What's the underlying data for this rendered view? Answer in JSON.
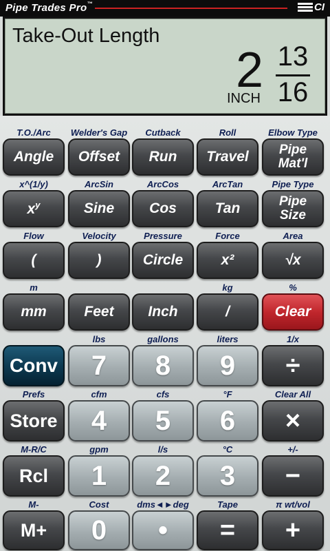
{
  "header": {
    "app_title": "Pipe Trades Pro",
    "tm": "™",
    "brand": "CI"
  },
  "display": {
    "label": "Take-Out Length",
    "whole": "2",
    "numerator": "13",
    "denominator": "16",
    "unit": "INCH"
  },
  "colors": {
    "clear_key": "#c1272d",
    "conv_key": "#0d3a52",
    "secondary_label": "#0e1e52",
    "lcd": "#c9d6c9"
  },
  "keys": {
    "row1": [
      {
        "sec": "T.O./Arc",
        "label": "Angle"
      },
      {
        "sec": "Welder's Gap",
        "label": "Offset"
      },
      {
        "sec": "Cutback",
        "label": "Run"
      },
      {
        "sec": "Roll",
        "label": "Travel"
      },
      {
        "sec": "Elbow Type",
        "label1": "Pipe",
        "label2": "Mat'l"
      }
    ],
    "row2": [
      {
        "sec": "x^(1/y)",
        "label": "x",
        "sup": "y"
      },
      {
        "sec": "ArcSin",
        "label": "Sine"
      },
      {
        "sec": "ArcCos",
        "label": "Cos"
      },
      {
        "sec": "ArcTan",
        "label": "Tan"
      },
      {
        "sec": "Pipe Type",
        "label1": "Pipe",
        "label2": "Size"
      }
    ],
    "row3": [
      {
        "sec": "Flow",
        "label": "("
      },
      {
        "sec": "Velocity",
        "label": ")"
      },
      {
        "sec": "Pressure",
        "label": "Circle"
      },
      {
        "sec": "Force",
        "label": "x²"
      },
      {
        "sec": "Area",
        "label": "√x"
      }
    ],
    "row4": [
      {
        "sec": "m",
        "label": "mm"
      },
      {
        "sec": "",
        "label": "Feet"
      },
      {
        "sec": "",
        "label": "Inch"
      },
      {
        "sec": "kg",
        "label": "/"
      },
      {
        "sec": "%",
        "label": "Clear"
      }
    ],
    "row5": [
      {
        "sec": "",
        "label": "Conv"
      },
      {
        "sec": "lbs",
        "label": "7"
      },
      {
        "sec": "gallons",
        "label": "8"
      },
      {
        "sec": "liters",
        "label": "9"
      },
      {
        "sec": "1/x",
        "label": "÷"
      }
    ],
    "row6": [
      {
        "sec": "Prefs",
        "label": "Store"
      },
      {
        "sec": "cfm",
        "label": "4"
      },
      {
        "sec": "cfs",
        "label": "5"
      },
      {
        "sec": "°F",
        "label": "6"
      },
      {
        "sec": "Clear All",
        "label": "×"
      }
    ],
    "row7": [
      {
        "sec": "M-R/C",
        "label": "Rcl"
      },
      {
        "sec": "gpm",
        "label": "1"
      },
      {
        "sec": "l/s",
        "label": "2"
      },
      {
        "sec": "°C",
        "label": "3"
      },
      {
        "sec": "+/-",
        "label": "−"
      }
    ],
    "row8": [
      {
        "sec": "M-",
        "label": "M+"
      },
      {
        "sec": "Cost",
        "label": "0"
      },
      {
        "sec": "dms◄►deg",
        "label": "•"
      },
      {
        "sec": "Tape",
        "label": "="
      },
      {
        "sec": "π wt/vol",
        "label": "+"
      }
    ]
  }
}
